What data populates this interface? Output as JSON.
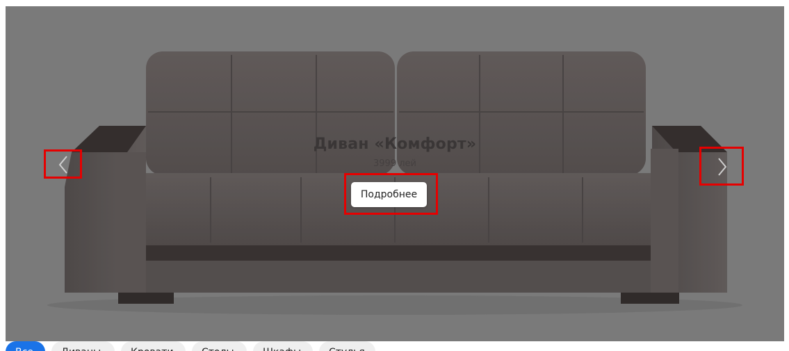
{
  "slider": {
    "title": "Диван «Комфорт»",
    "price": "3999 лей",
    "more_label": "Подробнее",
    "prev_icon": "chevron-left-icon",
    "next_icon": "chevron-right-icon",
    "highlight_color": "#e60000"
  },
  "tabs": [
    {
      "label": "Все",
      "active": true
    },
    {
      "label": "Диваны",
      "active": false
    },
    {
      "label": "Кровати",
      "active": false
    },
    {
      "label": "Столы",
      "active": false
    },
    {
      "label": "Шкафы",
      "active": false
    },
    {
      "label": "Стулья",
      "active": false
    }
  ],
  "colors": {
    "background": "#7b7b7b",
    "active_tab": "#1a73e8"
  }
}
